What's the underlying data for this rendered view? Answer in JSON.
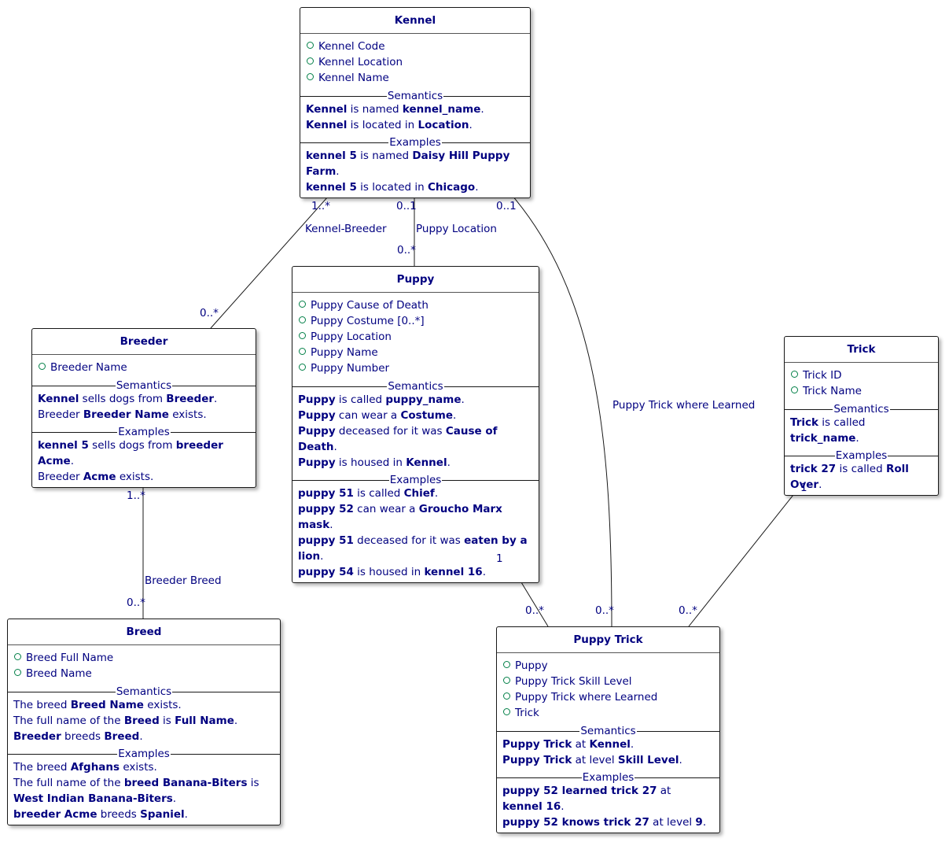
{
  "diagram_colors": {
    "text": "#000080",
    "attribute_marker": "#038048",
    "border": "#181818"
  },
  "sections": {
    "semantics": "Semantics",
    "examples": "Examples"
  },
  "classes": [
    {
      "name": "Kennel",
      "attributes": [
        "Kennel Code",
        "Kennel Location",
        "Kennel Name"
      ],
      "semantics": [
        [
          {
            "t": "Kennel",
            "bold": true
          },
          {
            "t": " is named "
          },
          {
            "t": "kennel_name",
            "bold": true
          },
          {
            "t": "."
          }
        ],
        [
          {
            "t": "Kennel",
            "bold": true
          },
          {
            "t": " is located in "
          },
          {
            "t": "Location",
            "bold": true
          },
          {
            "t": "."
          }
        ]
      ],
      "examples": [
        [
          {
            "t": "kennel 5",
            "bold": true
          },
          {
            "t": " is named "
          },
          {
            "t": "Daisy Hill Puppy Farm",
            "bold": true
          },
          {
            "t": "."
          }
        ],
        [
          {
            "t": "kennel 5",
            "bold": true
          },
          {
            "t": " is located in "
          },
          {
            "t": "Chicago",
            "bold": true
          },
          {
            "t": "."
          }
        ]
      ]
    },
    {
      "name": "Puppy",
      "attributes": [
        "Puppy Cause of Death",
        "Puppy Costume [0..*]",
        "Puppy Location",
        "Puppy Name",
        "Puppy Number"
      ],
      "semantics": [
        [
          {
            "t": "Puppy",
            "bold": true
          },
          {
            "t": " is called "
          },
          {
            "t": "puppy_name",
            "bold": true
          },
          {
            "t": "."
          }
        ],
        [
          {
            "t": "Puppy",
            "bold": true
          },
          {
            "t": " can wear a "
          },
          {
            "t": "Costume",
            "bold": true
          },
          {
            "t": "."
          }
        ],
        [
          {
            "t": "Puppy",
            "bold": true
          },
          {
            "t": " deceased for it was "
          },
          {
            "t": "Cause of Death",
            "bold": true
          },
          {
            "t": "."
          }
        ],
        [
          {
            "t": "Puppy",
            "bold": true
          },
          {
            "t": " is housed in "
          },
          {
            "t": "Kennel",
            "bold": true
          },
          {
            "t": "."
          }
        ]
      ],
      "examples": [
        [
          {
            "t": "puppy 51",
            "bold": true
          },
          {
            "t": " is called "
          },
          {
            "t": "Chief",
            "bold": true
          },
          {
            "t": "."
          }
        ],
        [
          {
            "t": "puppy 52",
            "bold": true
          },
          {
            "t": " can wear a "
          },
          {
            "t": "Groucho Marx mask",
            "bold": true
          },
          {
            "t": "."
          }
        ],
        [
          {
            "t": "puppy 51",
            "bold": true
          },
          {
            "t": " deceased for it was "
          },
          {
            "t": "eaten by a lion",
            "bold": true
          },
          {
            "t": "."
          }
        ],
        [
          {
            "t": "puppy 54",
            "bold": true
          },
          {
            "t": " is housed in "
          },
          {
            "t": "kennel 16",
            "bold": true
          },
          {
            "t": "."
          }
        ]
      ]
    },
    {
      "name": "Breeder",
      "attributes": [
        "Breeder Name"
      ],
      "semantics": [
        [
          {
            "t": "Kennel",
            "bold": true
          },
          {
            "t": " sells dogs from "
          },
          {
            "t": "Breeder",
            "bold": true
          },
          {
            "t": "."
          }
        ],
        [
          {
            "t": "Breeder "
          },
          {
            "t": "Breeder Name",
            "bold": true
          },
          {
            "t": " exists."
          }
        ]
      ],
      "examples": [
        [
          {
            "t": "kennel 5",
            "bold": true
          },
          {
            "t": " sells dogs from "
          },
          {
            "t": "breeder Acme",
            "bold": true
          },
          {
            "t": "."
          }
        ],
        [
          {
            "t": "Breeder "
          },
          {
            "t": "Acme",
            "bold": true
          },
          {
            "t": " exists."
          }
        ]
      ]
    },
    {
      "name": "Breed",
      "attributes": [
        "Breed Full Name",
        "Breed Name"
      ],
      "semantics": [
        [
          {
            "t": "The breed "
          },
          {
            "t": "Breed Name",
            "bold": true
          },
          {
            "t": " exists."
          }
        ],
        [
          {
            "t": "The full name of the "
          },
          {
            "t": "Breed",
            "bold": true
          },
          {
            "t": " is "
          },
          {
            "t": "Full Name",
            "bold": true
          },
          {
            "t": "."
          }
        ],
        [
          {
            "t": "Breeder",
            "bold": true
          },
          {
            "t": " breeds "
          },
          {
            "t": "Breed",
            "bold": true
          },
          {
            "t": "."
          }
        ]
      ],
      "examples": [
        [
          {
            "t": "The breed "
          },
          {
            "t": "Afghans",
            "bold": true
          },
          {
            "t": " exists."
          }
        ],
        [
          {
            "t": "The full name of the "
          },
          {
            "t": "breed Banana-Biters",
            "bold": true
          },
          {
            "t": " is "
          },
          {
            "t": "West Indian Banana-Biters",
            "bold": true
          },
          {
            "t": "."
          }
        ],
        [
          {
            "t": "breeder Acme",
            "bold": true
          },
          {
            "t": " breeds "
          },
          {
            "t": "Spaniel",
            "bold": true
          },
          {
            "t": "."
          }
        ]
      ]
    },
    {
      "name": "Trick",
      "attributes": [
        "Trick ID",
        "Trick Name"
      ],
      "semantics": [
        [
          {
            "t": "Trick",
            "bold": true
          },
          {
            "t": " is called "
          },
          {
            "t": "trick_name",
            "bold": true
          },
          {
            "t": "."
          }
        ]
      ],
      "examples": [
        [
          {
            "t": "trick 27",
            "bold": true
          },
          {
            "t": " is called "
          },
          {
            "t": "Roll Over",
            "bold": true
          },
          {
            "t": "."
          }
        ]
      ]
    },
    {
      "name": "Puppy Trick",
      "attributes": [
        "Puppy",
        "Puppy Trick Skill Level",
        "Puppy Trick where Learned",
        "Trick"
      ],
      "semantics": [
        [
          {
            "t": "Puppy Trick",
            "bold": true
          },
          {
            "t": " at "
          },
          {
            "t": "Kennel",
            "bold": true
          },
          {
            "t": "."
          }
        ],
        [
          {
            "t": "Puppy Trick",
            "bold": true
          },
          {
            "t": " at level "
          },
          {
            "t": "Skill Level",
            "bold": true
          },
          {
            "t": "."
          }
        ]
      ],
      "examples": [
        [
          {
            "t": "puppy 52 learned trick 27",
            "bold": true
          },
          {
            "t": " at "
          },
          {
            "t": "kennel 16",
            "bold": true
          },
          {
            "t": "."
          }
        ],
        [
          {
            "t": "puppy 52 knows trick 27",
            "bold": true
          },
          {
            "t": " at level "
          },
          {
            "t": "9",
            "bold": true
          },
          {
            "t": "."
          }
        ]
      ]
    }
  ],
  "associations": [
    {
      "name": "Kennel-Breeder",
      "from": "Kennel",
      "to": "Breeder",
      "from_mult": "1..*",
      "to_mult": "0..*"
    },
    {
      "name": "Puppy Location",
      "from": "Kennel",
      "to": "Puppy",
      "from_mult": "0..1",
      "to_mult": "0..*"
    },
    {
      "name": "Puppy Trick where Learned",
      "from": "Kennel",
      "to": "Puppy Trick",
      "from_mult": "0..1",
      "to_mult": "0..*"
    },
    {
      "name": "Breeder Breed",
      "from": "Breeder",
      "to": "Breed",
      "from_mult": "1..*",
      "to_mult": "0..*"
    },
    {
      "name": "",
      "from": "Puppy",
      "to": "Puppy Trick",
      "from_mult": "1",
      "to_mult": "0..*"
    },
    {
      "name": "",
      "from": "Trick",
      "to": "Puppy Trick",
      "from_mult": "1",
      "to_mult": "0..*"
    }
  ]
}
